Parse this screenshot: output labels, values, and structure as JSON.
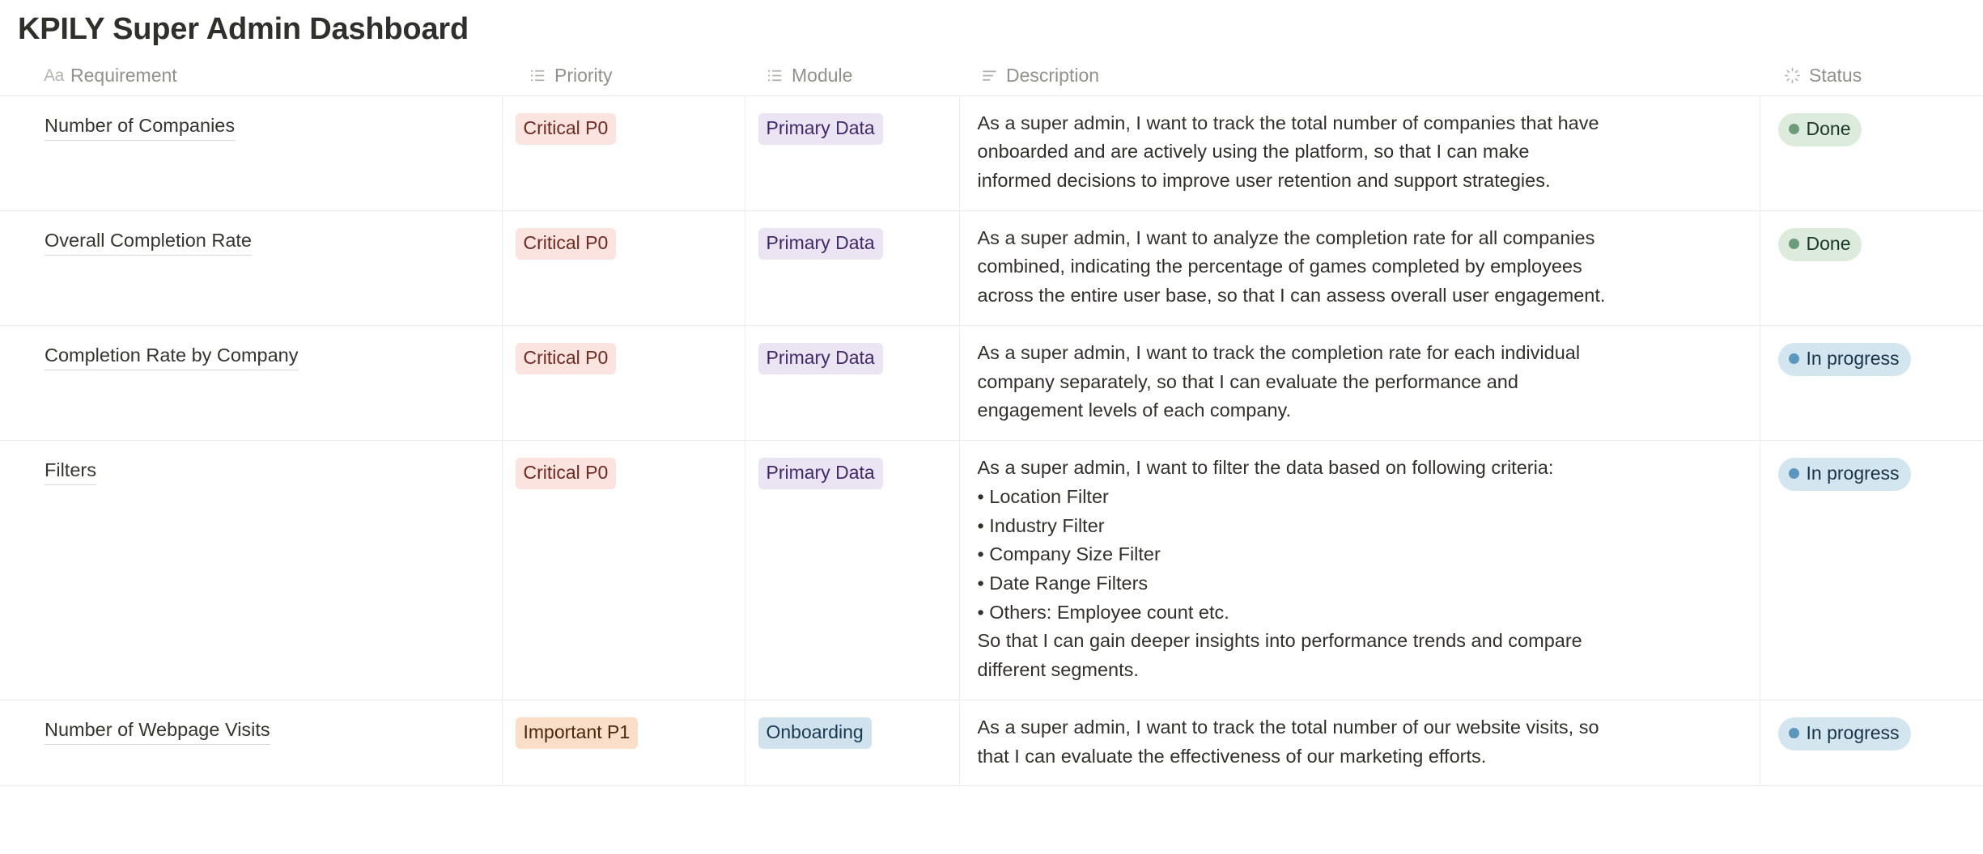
{
  "title": "KPILY Super Admin Dashboard",
  "columns": [
    {
      "label": "Requirement",
      "icon": "title-aa-icon"
    },
    {
      "label": "Priority",
      "icon": "select-list-icon"
    },
    {
      "label": "Module",
      "icon": "select-list-icon"
    },
    {
      "label": "Description",
      "icon": "text-lines-icon"
    },
    {
      "label": "Status",
      "icon": "status-spinner-icon"
    }
  ],
  "colors": {
    "tag_red_bg": "#fbe4e0",
    "tag_red_text": "#6e2a20",
    "tag_orange_bg": "#fadec8",
    "tag_orange_text": "#49290d",
    "tag_purple_bg": "#eae4f3",
    "tag_purple_text": "#412a68",
    "tag_blue_bg": "#cfe2ee",
    "tag_blue_text": "#193a53",
    "status_done_bg": "#dcebdc",
    "status_done_dot": "#6c9b7d",
    "status_inprogress_bg": "#d3e5ef",
    "status_inprogress_dot": "#5b97bd",
    "row_border": "#ececeb"
  },
  "rows": [
    {
      "requirement": "Number of Companies",
      "priority": "Critical P0",
      "module": "Primary Data",
      "description_lines": [
        "As a super admin, I want to track the total number of companies that have",
        "onboarded and are actively using the platform, so that I can make",
        "informed decisions to improve user retention and support strategies."
      ],
      "status": "Done"
    },
    {
      "requirement": "Overall Completion Rate",
      "priority": "Critical P0",
      "module": "Primary Data",
      "description_lines": [
        "As a super admin, I want to analyze the completion rate for all companies",
        "combined, indicating the percentage of games completed by employees",
        "across the entire user base, so that I can assess overall user engagement."
      ],
      "status": "Done"
    },
    {
      "requirement": "Completion Rate by Company",
      "priority": "Critical P0",
      "module": "Primary Data",
      "description_lines": [
        "As a super admin, I want to track the completion rate for each individual",
        "company separately, so that I can evaluate the performance and",
        "engagement levels of each company."
      ],
      "status": "In progress"
    },
    {
      "requirement": "Filters",
      "priority": "Critical P0",
      "module": "Primary Data",
      "description_lines": [
        "As a super admin, I want to filter the data based on following criteria:",
        "• Location Filter",
        "• Industry Filter",
        "• Company Size Filter",
        "• Date Range Filters",
        "• Others: Employee count etc.",
        "So that I can gain deeper insights into performance trends and compare",
        "different segments."
      ],
      "status": "In progress"
    },
    {
      "requirement": "Number of Webpage Visits",
      "priority": "Important P1",
      "module": "Onboarding",
      "description_lines": [
        "As a super admin, I want to track the total number of our website visits, so",
        "that I can evaluate the effectiveness of our marketing efforts."
      ],
      "status": "In progress"
    }
  ]
}
